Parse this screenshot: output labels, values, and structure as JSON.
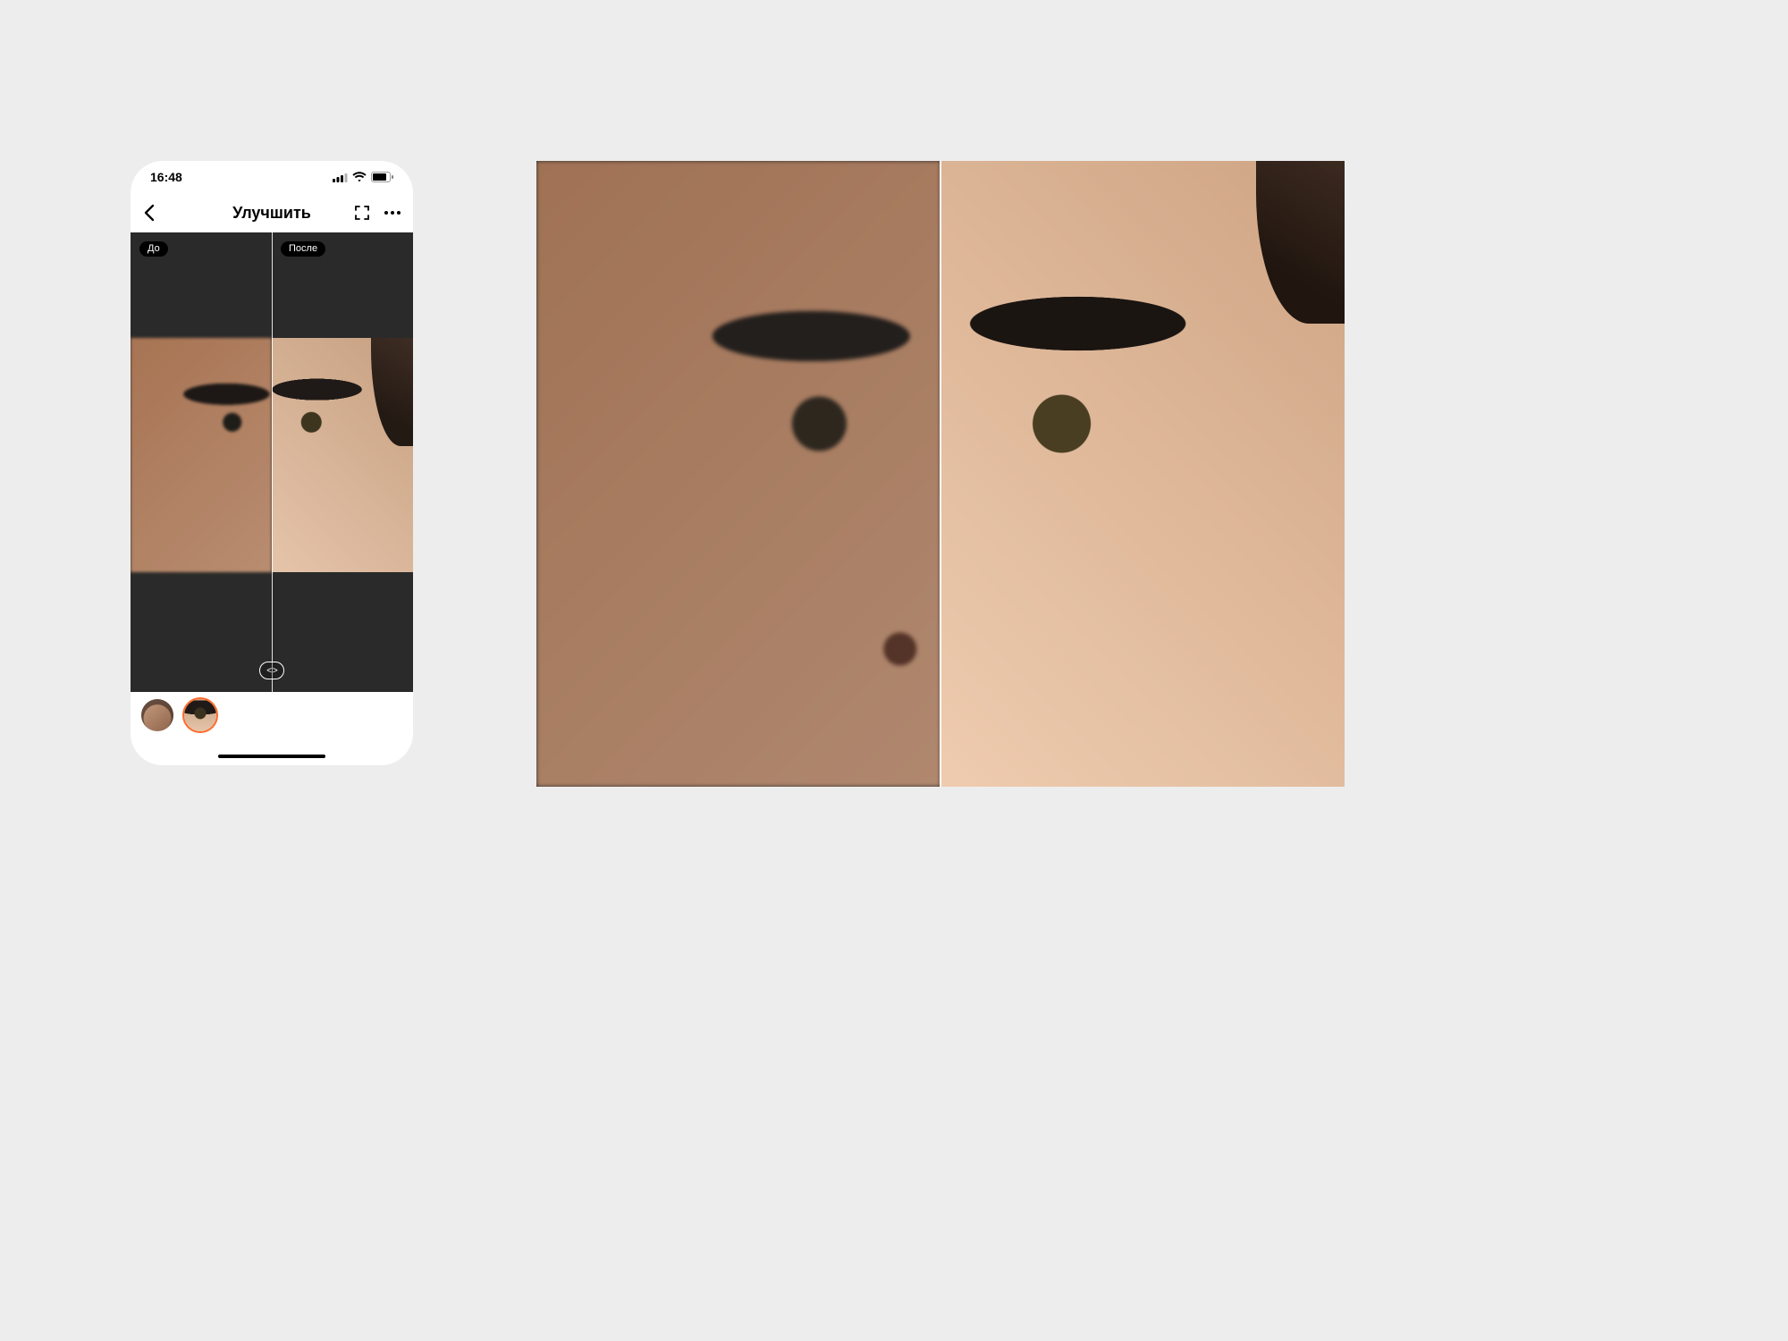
{
  "statusbar": {
    "time": "16:48"
  },
  "appbar": {
    "title": "Улучшить"
  },
  "editor": {
    "before_label": "До",
    "after_label": "После",
    "slider_glyph": "< >"
  },
  "thumbnails": [
    {
      "name": "full-face",
      "selected": false
    },
    {
      "name": "eye-zoom",
      "selected": true
    }
  ],
  "colors": {
    "accent": "#ff6a2b",
    "editor_bg": "#2a2a2a",
    "page_bg": "#ededed"
  }
}
